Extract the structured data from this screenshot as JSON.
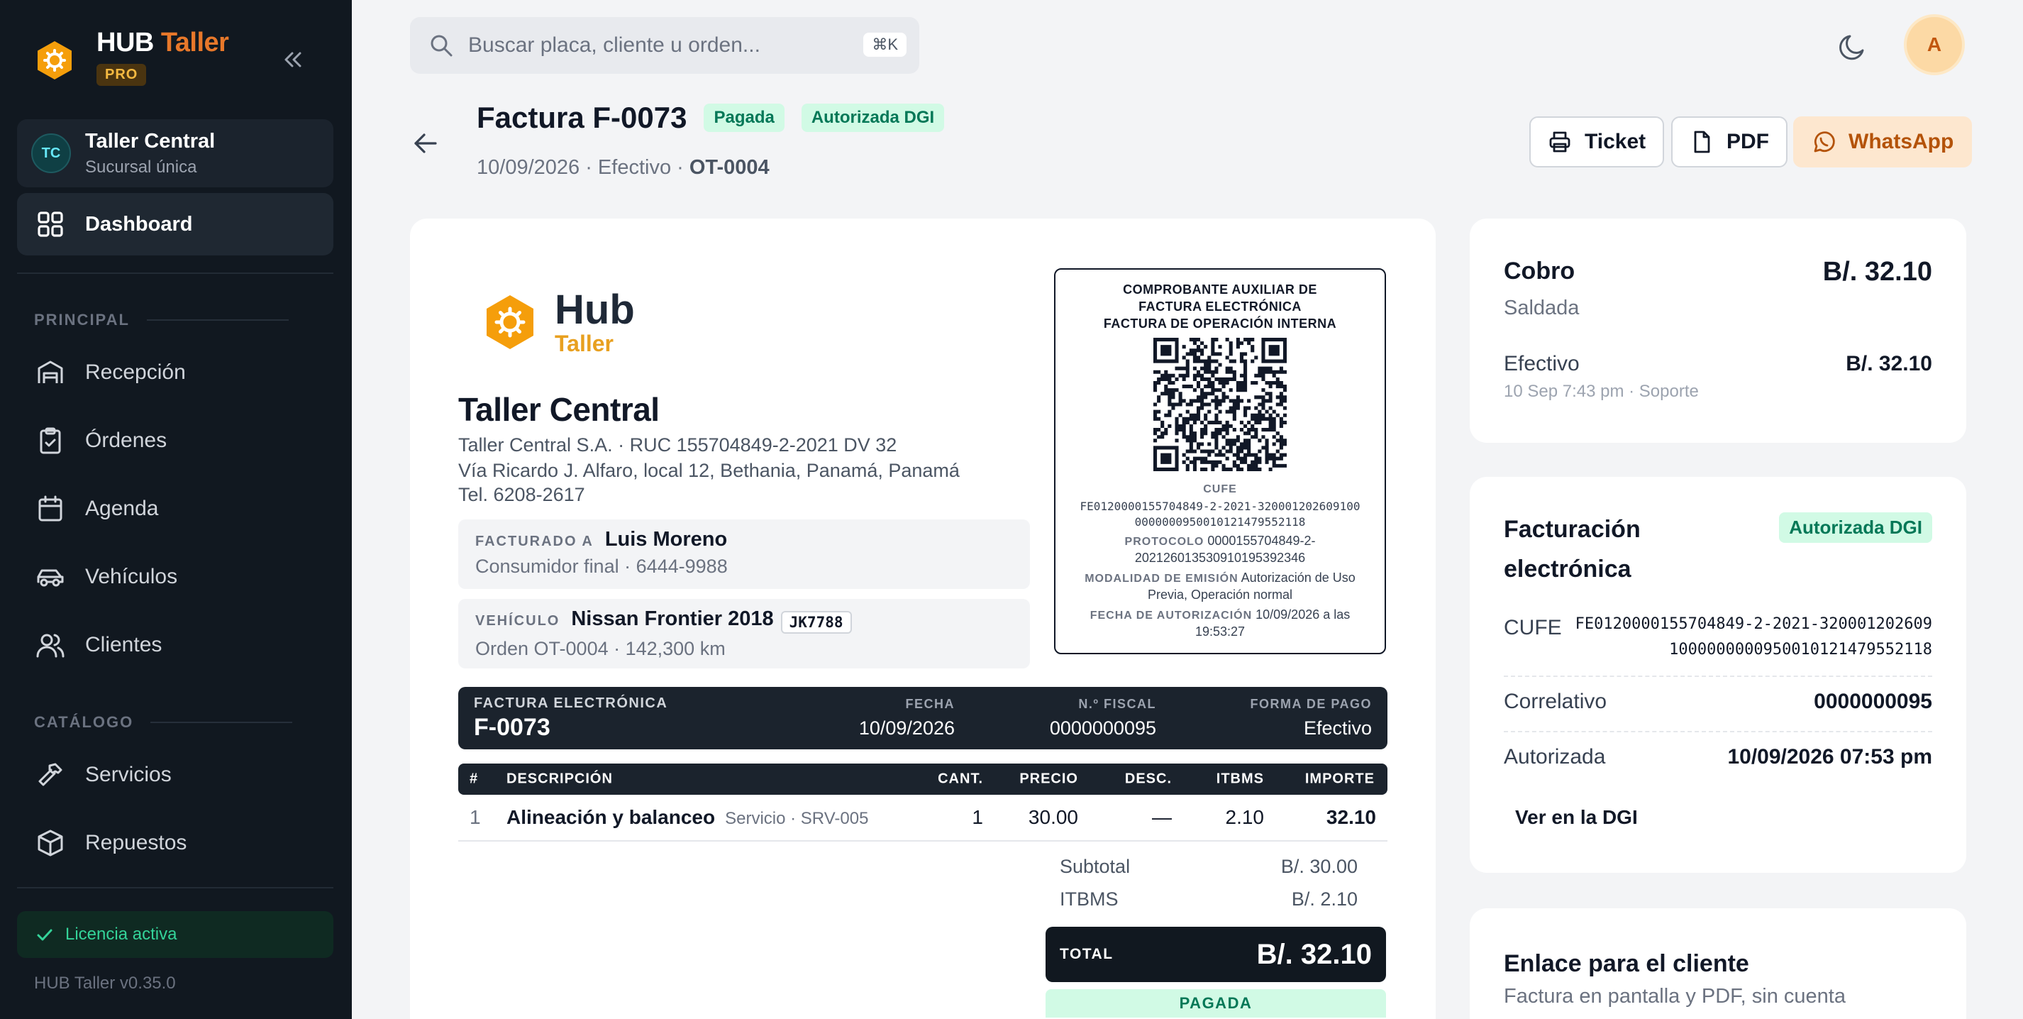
{
  "sidebar": {
    "brand_hub": "HUB",
    "brand_taller": "Taller",
    "pro": "PRO",
    "branch_initials": "TC",
    "branch_name": "Taller Central",
    "branch_sub": "Sucursal única",
    "active_item": "Dashboard",
    "section_principal": "PRINCIPAL",
    "section_catalogo": "CATÁLOGO",
    "items": [
      "Recepción",
      "Órdenes",
      "Agenda",
      "Vehículos",
      "Clientes",
      "Servicios",
      "Repuestos"
    ],
    "license": "Licencia activa",
    "version": "HUB Taller v0.35.0"
  },
  "topbar": {
    "search_placeholder": "Buscar placa, cliente u orden...",
    "shortcut": "⌘K",
    "avatar_initial": "A"
  },
  "header": {
    "title": "Factura F-0073",
    "badge_paid": "Pagada",
    "badge_dgi": "Autorizada DGI",
    "sub_prefix": "10/09/2026 · Efectivo · ",
    "sub_order": "OT-0004",
    "btn_ticket": "Ticket",
    "btn_pdf": "PDF",
    "btn_whatsapp": "WhatsApp"
  },
  "invoice": {
    "logo_hub": "Hub",
    "logo_taller": "Taller",
    "company": "Taller Central",
    "line1": "Taller Central S.A. · RUC 155704849-2-2021 DV 32",
    "line2": "Vía Ricardo J. Alfaro, local 12, Bethania, Panamá, Panamá",
    "line3": "Tel. 6208-2617",
    "billed_tag": "FACTURADO A",
    "billed_name": "Luis Moreno",
    "billed_sub": "Consumidor final · 6444-9988",
    "vehicle_tag": "VEHÍCULO",
    "vehicle_name": "Nissan Frontier 2018",
    "vehicle_plate": "JK7788",
    "vehicle_sub": "Orden OT-0004 · 142,300 km",
    "auth": {
      "title1": "COMPROBANTE AUXILIAR DE",
      "title2": "FACTURA ELECTRÓNICA",
      "title3": "FACTURA DE OPERACIÓN INTERNA",
      "cufe_label": "CUFE",
      "cufe_1": "FE0120000155704849-2-2021-320001202609100",
      "cufe_2": "000000095001012147955211​8",
      "protocol_label": "PROTOCOLO",
      "protocol_1": " 0000155704849-2-",
      "protocol_2": "2021260135309101953923​46",
      "modality_label": "MODALIDAD DE EMISIÓN",
      "modality_1": " Autorización de Uso",
      "modality_2": "Previa, Operación normal",
      "date_label": "FECHA DE AUTORIZACIÓN",
      "date_1": " 10/09/2026 a las",
      "date_2": "19:53:27"
    },
    "band_tag": "FACTURA ELECTRÓNICA",
    "band_number": "F-0073",
    "band_date_label": "FECHA",
    "band_date": "10/09/2026",
    "band_fiscal_label": "N.º FISCAL",
    "band_fiscal": "0000000095",
    "band_payment_label": "FORMA DE PAGO",
    "band_payment": "Efectivo",
    "columns": [
      "#",
      "DESCRIPCIÓN",
      "CANT.",
      "PRECIO",
      "DESC.",
      "ITBMS",
      "IMPORTE"
    ],
    "row": {
      "n": "1",
      "desc": "Alineación y balanceo",
      "desc_sub": "Servicio · SRV-005",
      "qty": "1",
      "price": "30.00",
      "disc": "—",
      "itbms": "2.10",
      "amount": "32.10"
    },
    "subtotal_label": "Subtotal",
    "subtotal": "B/. 30.00",
    "itbms_label": "ITBMS",
    "itbms": "B/. 2.10",
    "total_label": "TOTAL",
    "total": "B/. 32.10",
    "paid_strip": "PAGADA"
  },
  "cobro": {
    "title": "Cobro",
    "amount": "B/. 32.10",
    "status": "Saldada",
    "method": "Efectivo",
    "method_amount": "B/. 32.10",
    "method_meta": "10 Sep 7:43 pm · Soporte"
  },
  "fe": {
    "title1": "Facturación",
    "title2": "electrónica",
    "badge": "Autorizada DGI",
    "cufe_label": "CUFE",
    "cufe_1": "FE0120000155704849-2-2021-320001202609",
    "cufe_2": "100000000095001012147955211​8",
    "correlativo_label": "Correlativo",
    "correlativo": "0000000095",
    "autorizada_label": "Autorizada",
    "autorizada": "10/09/2026 07:53 pm",
    "link": "Ver en la DGI"
  },
  "enlace": {
    "title": "Enlace para el cliente",
    "sub": "Factura en pantalla y PDF, sin cuenta"
  },
  "colors": {
    "sidebar_bg": "#111820",
    "accent_orange": "#e8782a",
    "success_green": "#047857"
  }
}
